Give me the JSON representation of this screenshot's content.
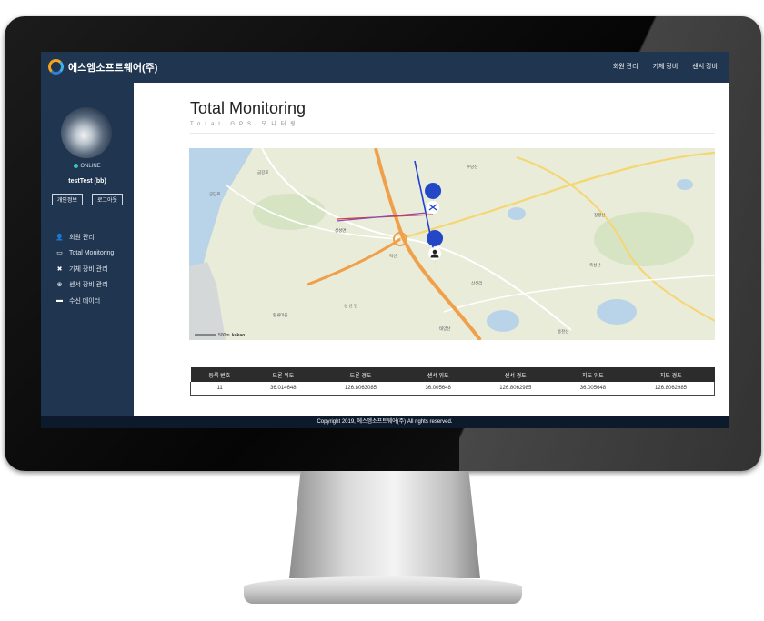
{
  "app": {
    "brand": "에스엠소프트웨어(주)",
    "logo_icon": "company-logo-icon"
  },
  "topnav": {
    "items": [
      "회원 관리",
      "기체 장비",
      "센서 장비"
    ]
  },
  "sidebar": {
    "status": "ONLINE",
    "status_color": "#35c9b4",
    "username": "testTest (bb)",
    "buttons": [
      "개인정보",
      "로그아웃"
    ],
    "menu": [
      {
        "icon": "user-icon",
        "glyph": "👤",
        "label": "회원 관리"
      },
      {
        "icon": "monitor-icon",
        "glyph": "▭",
        "label": "Total Monitoring"
      },
      {
        "icon": "drone-icon",
        "glyph": "✖",
        "label": "기체 장비 관리"
      },
      {
        "icon": "crosshair-icon",
        "glyph": "⊕",
        "label": "센서 장비 관리"
      },
      {
        "icon": "data-icon",
        "glyph": "▬",
        "label": "수신 데이터"
      }
    ]
  },
  "page": {
    "title": "Total Monitoring",
    "subtitle": "Total GPS 모니터링"
  },
  "map": {
    "scale_label": "500m",
    "provider": "kakao",
    "labels": [
      "금강로",
      "공단로",
      "삼성면",
      "성 산 면",
      "수당산",
      "덕산",
      "축성산",
      "태양산",
      "용천산",
      "장평산",
      "황새마을",
      "상신리"
    ]
  },
  "table": {
    "headers": [
      "등록 번호",
      "드론 위도",
      "드론 경도",
      "센서 위도",
      "센서 경도",
      "지도 위도",
      "지도 경도"
    ],
    "rows": [
      [
        "11",
        "36.014648",
        "126.8063085",
        "36.005648",
        "126.8062985",
        "36.005648",
        "126.8062985"
      ]
    ]
  },
  "footer": {
    "text": "Copyright 2019, 에스엠소프트웨어(주) All rights reserved."
  },
  "colors": {
    "navy": "#1f3550",
    "road_orange": "#f0a04b",
    "drone_line": "#1f3fd6",
    "sensor_line": "#d63a3a"
  }
}
